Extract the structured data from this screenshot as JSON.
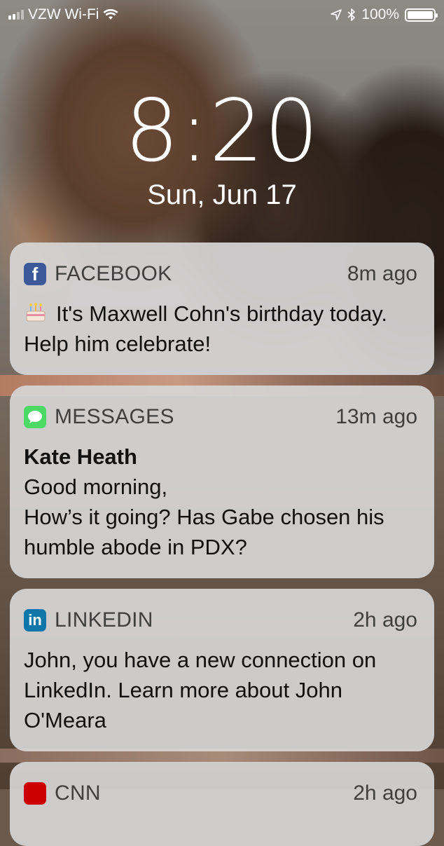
{
  "status_bar": {
    "carrier": "VZW Wi-Fi",
    "battery": "100%"
  },
  "lock_screen": {
    "time": "8:20",
    "date": "Sun, Jun 17"
  },
  "notifications": [
    {
      "app": "FACEBOOK",
      "time": "8m ago",
      "icon": "facebook-icon",
      "body": "It's Maxwell Cohn's birthday today. Help him celebrate!"
    },
    {
      "app": "MESSAGES",
      "time": "13m ago",
      "icon": "messages-icon",
      "sender": "Kate Heath",
      "body_line1": "Good morning,",
      "body_line2": "How’s it going? Has Gabe chosen his humble abode in PDX?"
    },
    {
      "app": "LINKEDIN",
      "time": "2h ago",
      "icon": "linkedin-icon",
      "body": "John, you have a new connection on LinkedIn. Learn more about John O'Meara"
    },
    {
      "app": "CNN",
      "time": "2h ago",
      "icon": "cnn-icon"
    }
  ],
  "colors": {
    "card_bg": "#d6d5d5",
    "facebook": "#3b5998",
    "messages": "#4cd964",
    "linkedin": "#0e76a8",
    "cnn": "#cc0000"
  }
}
